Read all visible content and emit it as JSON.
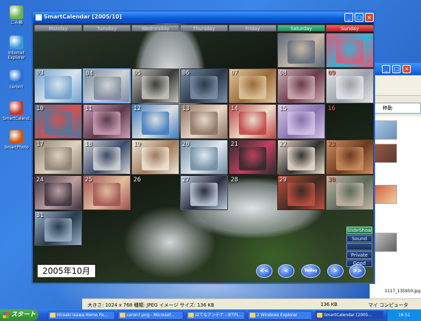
{
  "desktop": {
    "icons": [
      {
        "label": "ごみ箱",
        "color": "#6ab04c"
      },
      {
        "label": "Internet Explorer",
        "color": "#3a9ad9"
      },
      {
        "label": "ceron?",
        "color": "#2a6fd0"
      },
      {
        "label": "SmartCalend...",
        "color": "#c0392b"
      },
      {
        "label": "SmartPhoto",
        "color": "#d35400"
      }
    ]
  },
  "bg_window": {
    "address_suffix": "移動",
    "file_label": "1117_135950.jpg"
  },
  "bg_status": {
    "left": "大きさ: 1024 x 768 種類: JPEG イメージ サイズ: 136 KB",
    "size": "136 KB",
    "location": "マイ コンピュータ"
  },
  "window": {
    "title": "SmartCalendar [2005/10]",
    "minimize": "_",
    "maximize": "□",
    "close": "×"
  },
  "day_headers": [
    "Monday",
    "Tuesday",
    "Wednesday",
    "Thursday",
    "Friday",
    "Saturday",
    "Sunday"
  ],
  "colors": {
    "saturday": "#1f8f5c",
    "sunday": "#c41e1e",
    "titlebar": "#0a58d8"
  },
  "days": [
    {
      "num": "",
      "photo": true,
      "c1": "#5a6a7a",
      "c2": "#c8b8a8"
    },
    {
      "num": "",
      "photo": true,
      "c1": "#e05a7a",
      "c2": "#3ab0d0"
    },
    {
      "num": "03",
      "photo": true,
      "c1": "#6fa0d0",
      "c2": "#d8e4ec"
    },
    {
      "num": "04",
      "photo": true,
      "c1": "#7a8a9a",
      "c2": "#d0d4d8"
    },
    {
      "num": "05",
      "photo": true,
      "c1": "#c8c8c0",
      "c2": "#3a3a3a"
    },
    {
      "num": "06",
      "photo": true,
      "c1": "#8090a8",
      "c2": "#283848"
    },
    {
      "num": "07",
      "photo": true,
      "c1": "#e0c8a0",
      "c2": "#9a6a3a"
    },
    {
      "num": "08",
      "photo": true,
      "c1": "#d0b0b8",
      "c2": "#6a3a4a"
    },
    {
      "num": "09",
      "photo": true,
      "c1": "#e8e8e8",
      "c2": "#9aa0a8"
    },
    {
      "num": "10",
      "photo": true,
      "c1": "#4a7aa0",
      "c2": "#d05050"
    },
    {
      "num": "11",
      "photo": true,
      "c1": "#d0a0b8",
      "c2": "#5a3a4a"
    },
    {
      "num": "12",
      "photo": true,
      "c1": "#3a78c0",
      "c2": "#e0e0e0"
    },
    {
      "num": "13",
      "photo": true,
      "c1": "#8a7060",
      "c2": "#e8d8c8"
    },
    {
      "num": "14",
      "photo": true,
      "c1": "#c04040",
      "c2": "#e8e0d0"
    },
    {
      "num": "15",
      "photo": true,
      "c1": "#d8c8e8",
      "c2": "#8870b0"
    },
    {
      "num": "16",
      "photo": false,
      "c1": "#000000",
      "c2": "#000000"
    },
    {
      "num": "17",
      "photo": true,
      "c1": "#8a8070",
      "c2": "#e0d0c0"
    },
    {
      "num": "18",
      "photo": true,
      "c1": "#d8d8d8",
      "c2": "#3a4a6a"
    },
    {
      "num": "19",
      "photo": true,
      "c1": "#f0e8d8",
      "c2": "#a07a5a"
    },
    {
      "num": "20",
      "photo": true,
      "c1": "#6a8aa0",
      "c2": "#e0e8f0"
    },
    {
      "num": "21",
      "photo": true,
      "c1": "#2a2a2a",
      "c2": "#c04060"
    },
    {
      "num": "22",
      "photo": true,
      "c1": "#f0e0d0",
      "c2": "#303030"
    },
    {
      "num": "23",
      "photo": true,
      "c1": "#d09060",
      "c2": "#6a3a20"
    },
    {
      "num": "24",
      "photo": true,
      "c1": "#3a3040",
      "c2": "#c0a0a0"
    },
    {
      "num": "25",
      "photo": true,
      "c1": "#a05050",
      "c2": "#e0c0a0"
    },
    {
      "num": "26",
      "photo": false,
      "c1": "#000000",
      "c2": "#000000"
    },
    {
      "num": "27",
      "photo": true,
      "c1": "#c0d0e0",
      "c2": "#2a2a3a"
    },
    {
      "num": "28",
      "photo": false,
      "c1": "#000000",
      "c2": "#000000"
    },
    {
      "num": "29",
      "photo": true,
      "c1": "#c05040",
      "c2": "#3a2a20"
    },
    {
      "num": "30",
      "photo": true,
      "c1": "#c8b8a8",
      "c2": "#5a6a5a"
    },
    {
      "num": "31",
      "photo": true,
      "c1": "#9ab0c8",
      "c2": "#2a3a4a"
    }
  ],
  "side_buttons": [
    "SlideShow",
    "Sound",
    "",
    "Private",
    "Good"
  ],
  "month_label": "2005年10月",
  "nav_buttons": [
    "<<",
    "<",
    "Today",
    ">",
    ">>"
  ],
  "taskbar": {
    "start_label": "スタート",
    "tasks": [
      "Hiroaki Isawa Home Pa...",
      "ceron?.png - Microsof...",
      "はてなアンテナ - IETPL...",
      "2 Windows Explorer",
      "SmartCalendar [2005..."
    ],
    "clock": "16:51"
  }
}
